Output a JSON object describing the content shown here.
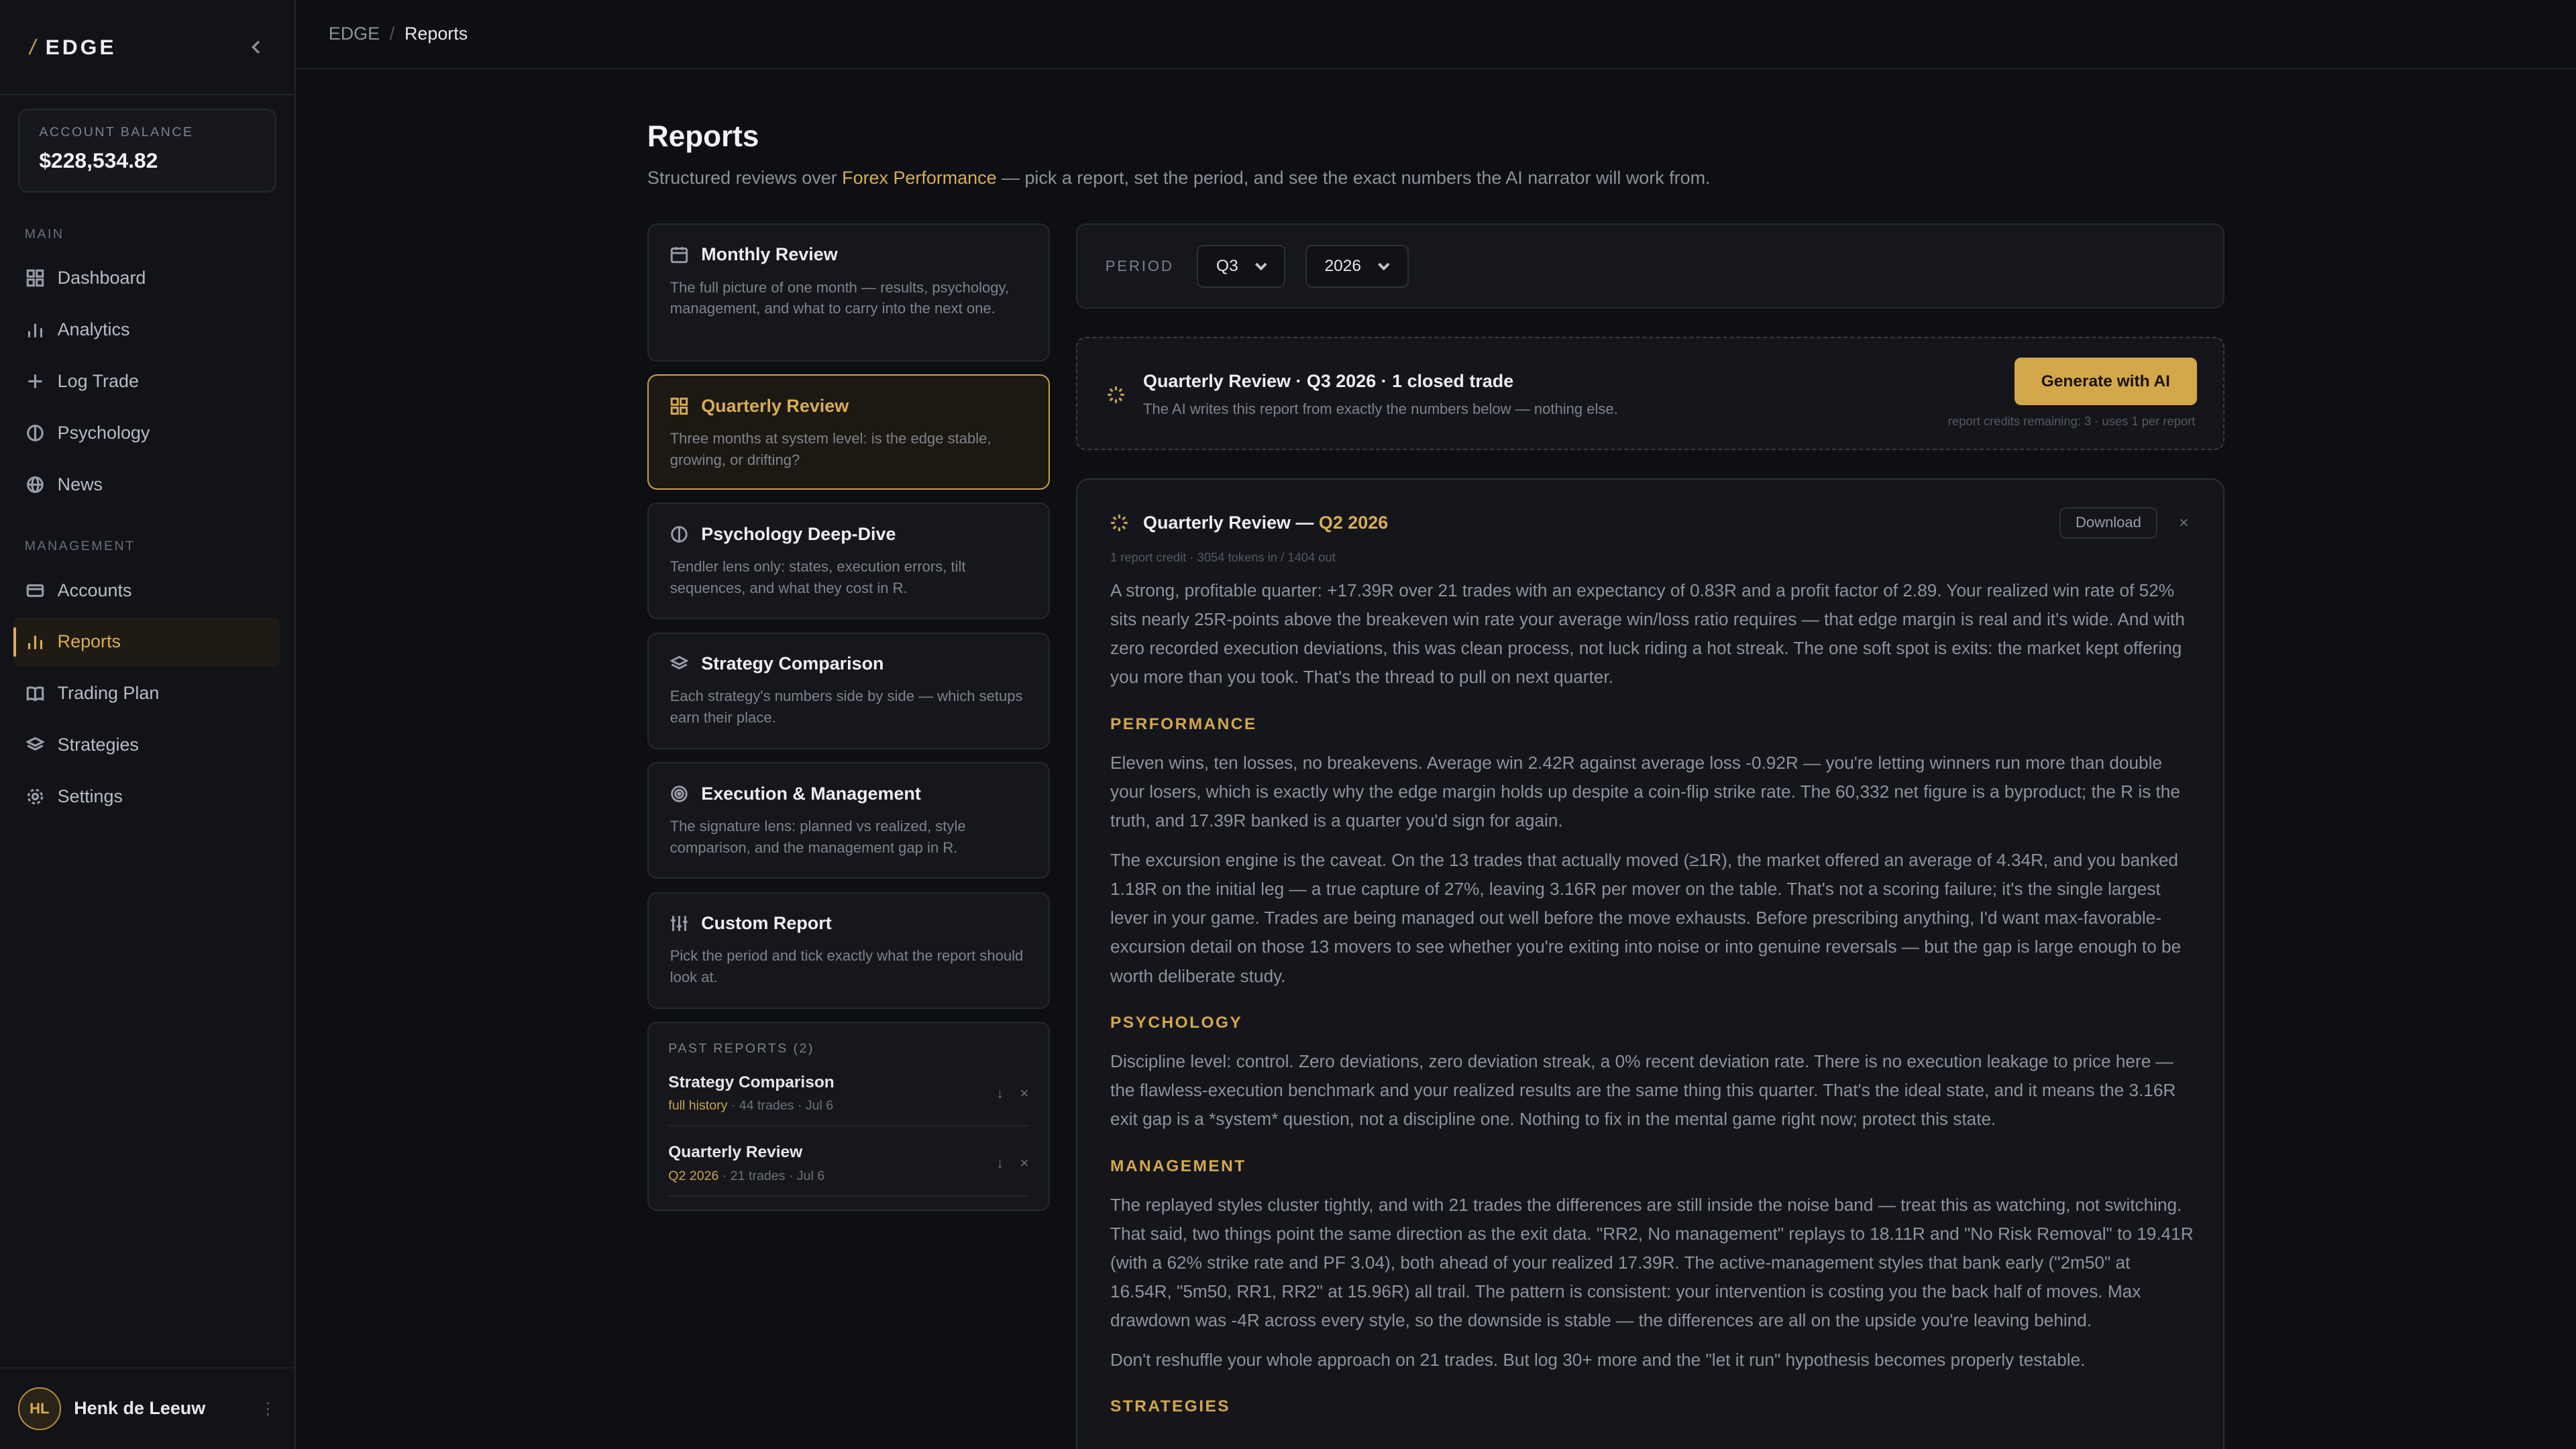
{
  "brand": {
    "mark": "/",
    "name": "EDGE"
  },
  "account": {
    "label": "ACCOUNT BALANCE",
    "value": "$228,534.82"
  },
  "nav": {
    "main_label": "MAIN",
    "main_items": [
      {
        "label": "Dashboard",
        "icon": "grid-icon"
      },
      {
        "label": "Analytics",
        "icon": "bar-chart-icon"
      },
      {
        "label": "Log Trade",
        "icon": "plus-icon"
      },
      {
        "label": "Psychology",
        "icon": "brain-icon"
      },
      {
        "label": "News",
        "icon": "globe-icon"
      }
    ],
    "management_label": "MANAGEMENT",
    "management_items": [
      {
        "label": "Accounts",
        "icon": "wallet-icon"
      },
      {
        "label": "Reports",
        "icon": "bar-chart-icon",
        "active": true
      },
      {
        "label": "Trading Plan",
        "icon": "book-icon"
      },
      {
        "label": "Strategies",
        "icon": "layers-icon"
      },
      {
        "label": "Settings",
        "icon": "gear-icon"
      }
    ]
  },
  "user": {
    "initials": "HL",
    "name": "Henk de Leeuw",
    "menu": "⋮"
  },
  "breadcrumb": {
    "root": "EDGE",
    "sep": "/",
    "current": "Reports"
  },
  "page": {
    "title": "Reports",
    "subtitle_pre": "Structured reviews over ",
    "subtitle_link": "Forex Performance",
    "subtitle_post": " — pick a report, set the period, and see the exact numbers the AI narrator will work from."
  },
  "reports": [
    {
      "title": "Monthly Review",
      "icon": "calendar-icon",
      "desc": "The full picture of one month — results, psychology, management, and what to carry into the next one."
    },
    {
      "title": "Quarterly Review",
      "icon": "grid-icon",
      "desc": "Three months at system level: is the edge stable, growing, or drifting?",
      "active": true
    },
    {
      "title": "Psychology Deep-Dive",
      "icon": "brain-icon",
      "desc": "Tendler lens only: states, execution errors, tilt sequences, and what they cost in R."
    },
    {
      "title": "Strategy Comparison",
      "icon": "layers-icon",
      "desc": "Each strategy's numbers side by side — which setups earn their place."
    },
    {
      "title": "Execution & Management",
      "icon": "target-icon",
      "desc": "The signature lens: planned vs realized, style comparison, and the management gap in R."
    },
    {
      "title": "Custom Report",
      "icon": "sliders-icon",
      "desc": "Pick the period and tick exactly what the report should look at."
    }
  ],
  "past": {
    "label": "PAST REPORTS (2)",
    "items": [
      {
        "title": "Strategy Comparison",
        "period": "full history",
        "meta": " · 44 trades · Jul 6"
      },
      {
        "title": "Quarterly Review",
        "period": "Q2 2026",
        "meta": " · 21 trades · Jul 6"
      }
    ]
  },
  "period": {
    "label": "PERIOD",
    "quarter": "Q3",
    "year": "2026"
  },
  "generate": {
    "title": "Quarterly Review · Q3 2026 · 1 closed trade",
    "subtitle": "The AI writes this report from exactly the numbers below — nothing else.",
    "button": "Generate with AI",
    "credits": "report credits remaining: 3 · uses 1 per report"
  },
  "narrative": {
    "title_pre": "Quarterly Review — ",
    "title_period": "Q2 2026",
    "meta": "1 report credit · 3054 tokens in / 1404 out",
    "download": "Download",
    "close": "×",
    "intro": "A strong, profitable quarter: +17.39R over 21 trades with an expectancy of 0.83R and a profit factor of 2.89. Your realized win rate of 52% sits nearly 25R-points above the breakeven win rate your average win/loss ratio requires — that edge margin is real and it's wide. And with zero recorded execution deviations, this was clean process, not luck riding a hot streak. The one soft spot is exits: the market kept offering you more than you took. That's the thread to pull on next quarter.",
    "performance_heading": "PERFORMANCE",
    "performance_1": "Eleven wins, ten losses, no breakevens. Average win 2.42R against average loss -0.92R — you're letting winners run more than double your losers, which is exactly why the edge margin holds up despite a coin-flip strike rate. The 60,332 net figure is a byproduct; the R is the truth, and 17.39R banked is a quarter you'd sign for again.",
    "performance_2": "The excursion engine is the caveat. On the 13 trades that actually moved (≥1R), the market offered an average of 4.34R, and you banked 1.18R on the initial leg — a true capture of 27%, leaving 3.16R per mover on the table. That's not a scoring failure; it's the single largest lever in your game. Trades are being managed out well before the move exhausts. Before prescribing anything, I'd want max-favorable-excursion detail on those 13 movers to see whether you're exiting into noise or into genuine reversals — but the gap is large enough to be worth deliberate study.",
    "psychology_heading": "PSYCHOLOGY",
    "psychology_1": "Discipline level: control. Zero deviations, zero deviation streak, a 0% recent deviation rate. There is no execution leakage to price here — the flawless-execution benchmark and your realized results are the same thing this quarter. That's the ideal state, and it means the 3.16R exit gap is a *system* question, not a discipline one. Nothing to fix in the mental game right now; protect this state.",
    "management_heading": "MANAGEMENT",
    "management_1": "The replayed styles cluster tightly, and with 21 trades the differences are still inside the noise band — treat this as watching, not switching. That said, two things point the same direction as the exit data. \"RR2, No management\" replays to 18.11R and \"No Risk Removal\" to 19.41R (with a 62% strike rate and PF 3.04), both ahead of your realized 17.39R. The active-management styles that bank early (\"2m50\" at 16.54R, \"5m50, RR1, RR2\" at 15.96R) all trail. The pattern is consistent: your intervention is costing you the back half of moves. Max drawdown was -4R across every style, so the downside is stable — the differences are all on the upside you're leaving behind.",
    "management_2": "Don't reshuffle your whole approach on 21 trades. But log 30+ more and the \"let it run\" hypothesis becomes properly testable.",
    "strategies_heading": "STRATEGIES"
  }
}
